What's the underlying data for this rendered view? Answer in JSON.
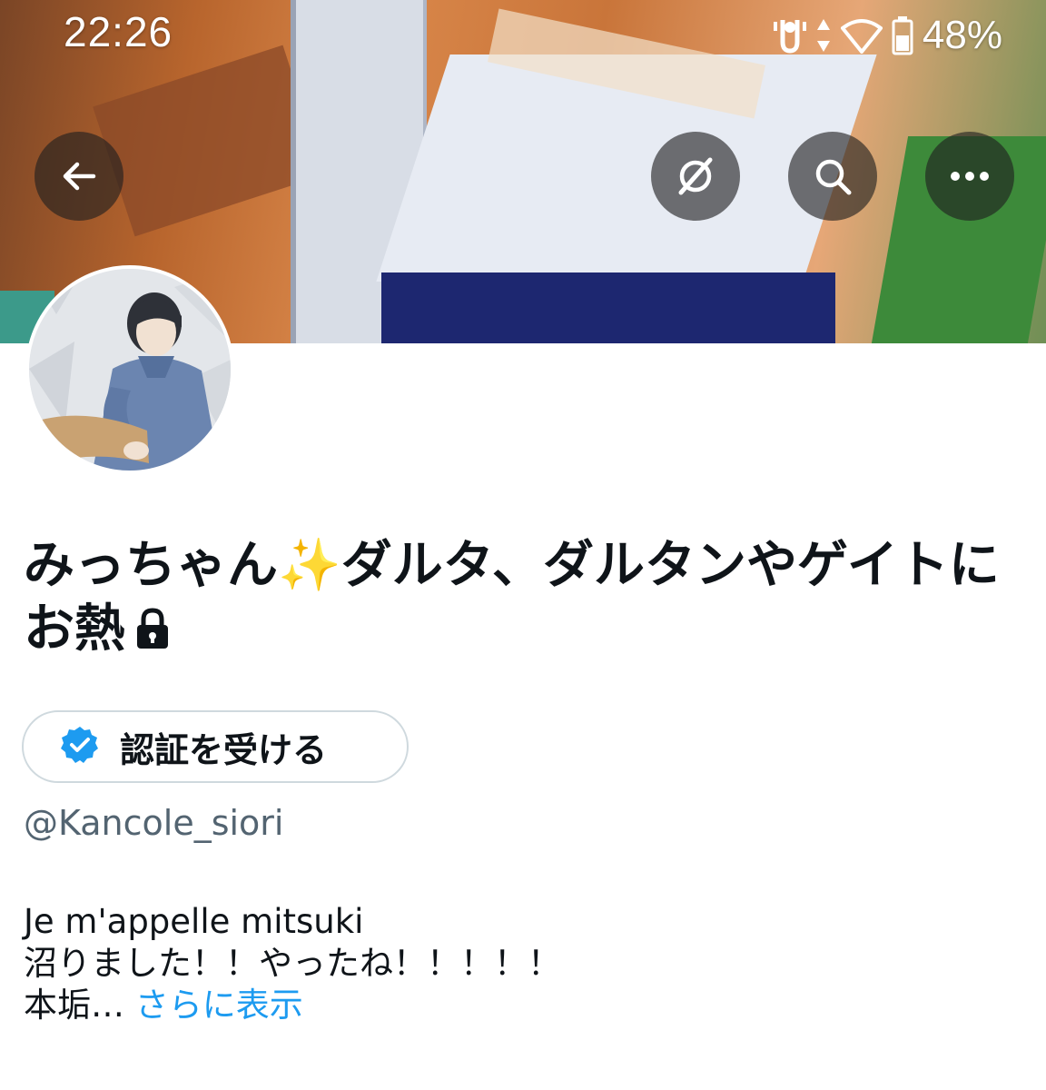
{
  "status_bar": {
    "time": "22:26",
    "battery": "48%",
    "icons": [
      "vibrate-icon",
      "data-arrows-icon",
      "wifi-icon",
      "battery-icon"
    ]
  },
  "header": {
    "back_icon": "arrow-left-icon",
    "grok_icon": "grok-icon",
    "search_icon": "search-icon",
    "more_icon": "more-horizontal-icon"
  },
  "profile": {
    "display_name": "みっちゃん✨ダルタ、ダルタンやゲイトにお熱",
    "protected_icon": "lock-icon",
    "verify_button_label": "認証を受ける",
    "handle": "@Kancole_siori",
    "bio_lines": [
      "Je m'appelle mitsuki",
      "沼りました！！やったね！！！！！",
      "本垢…"
    ],
    "show_more": "さらに表示"
  },
  "colors": {
    "accent": "#1d9bf0",
    "text": "#0f1419",
    "secondary_text": "#536471",
    "border": "#cfd9de"
  }
}
